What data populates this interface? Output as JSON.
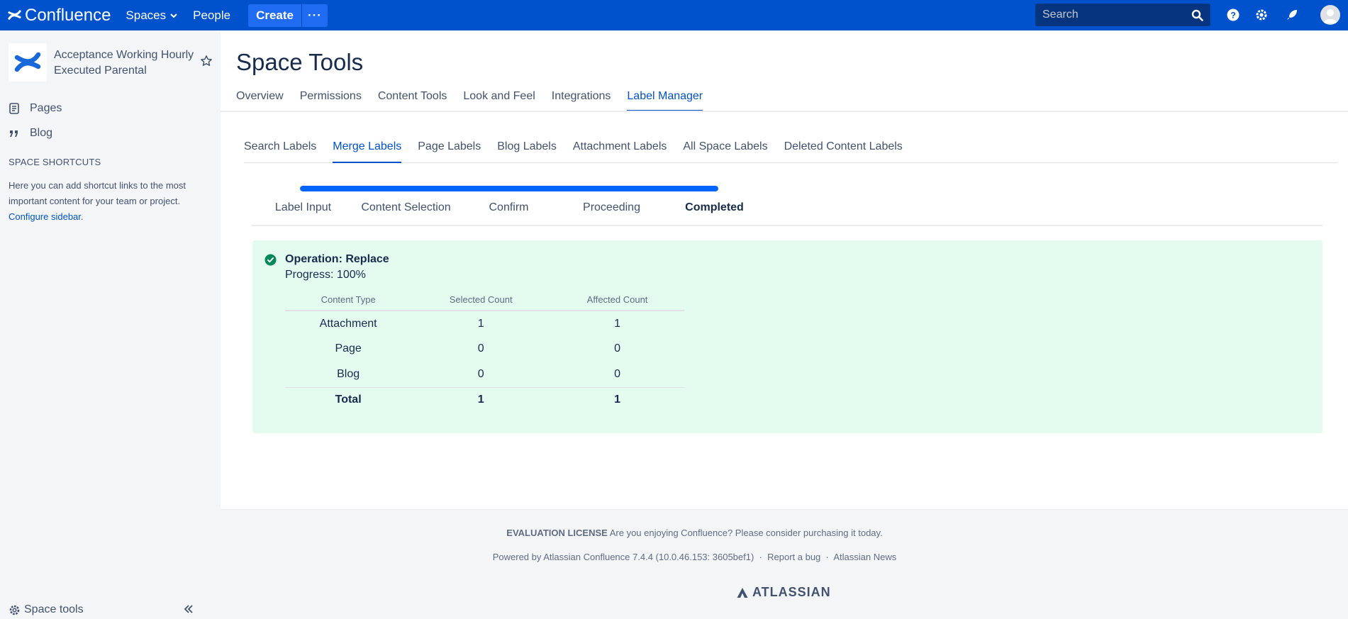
{
  "topnav": {
    "brand": "Confluence",
    "spaces": "Spaces",
    "people": "People",
    "create": "Create",
    "more": "···",
    "search_placeholder": "Search"
  },
  "sidebar": {
    "space_name": "Acceptance Working Hourly Executed Parental",
    "pages": "Pages",
    "blog": "Blog",
    "shortcuts_title": "SPACE SHORTCUTS",
    "shortcuts_text": "Here you can add shortcut links to the most important content for your team or project.",
    "configure_link": "Configure sidebar",
    "configure_suffix": ".",
    "space_tools": "Space tools"
  },
  "main": {
    "title": "Space Tools",
    "tabs": [
      "Overview",
      "Permissions",
      "Content Tools",
      "Look and Feel",
      "Integrations",
      "Label Manager"
    ],
    "subtabs": [
      "Search Labels",
      "Merge Labels",
      "Page Labels",
      "Blog Labels",
      "Attachment Labels",
      "All Space Labels",
      "Deleted Content Labels"
    ],
    "progress_fraction": 1.0,
    "steps": [
      "Label Input",
      "Content Selection",
      "Confirm",
      "Proceeding",
      "Completed"
    ],
    "result": {
      "title": "Operation: Replace",
      "progress": "Progress: 100%",
      "headers": [
        "Content Type",
        "Selected Count",
        "Affected Count"
      ],
      "rows": [
        [
          "Attachment",
          "1",
          "1"
        ],
        [
          "Page",
          "0",
          "0"
        ],
        [
          "Blog",
          "0",
          "0"
        ]
      ],
      "total": [
        "Total",
        "1",
        "1"
      ]
    }
  },
  "footer": {
    "license_label": "EVALUATION LICENSE",
    "license_text": "Are you enjoying Confluence? Please consider purchasing it today.",
    "powered": "Powered by Atlassian Confluence 7.4.4 (10.0.46.153: 3605bef1)",
    "sep": "·",
    "report_bug": "Report a bug",
    "news": "Atlassian News",
    "brand": "ATLASSIAN"
  },
  "colors": {
    "nav": "#0052cc",
    "accent": "#0052cc",
    "success_bg": "#e3fcef",
    "success_icon": "#00875a"
  },
  "icons": [
    "confluence-logo-icon",
    "chevron-down-icon",
    "search-icon",
    "help-icon",
    "settings-icon",
    "notifications-icon",
    "avatar-icon",
    "star-icon",
    "pages-icon",
    "blog-quote-icon",
    "gear-icon",
    "collapse-icon",
    "check-circle-icon",
    "atlassian-logo-icon"
  ]
}
